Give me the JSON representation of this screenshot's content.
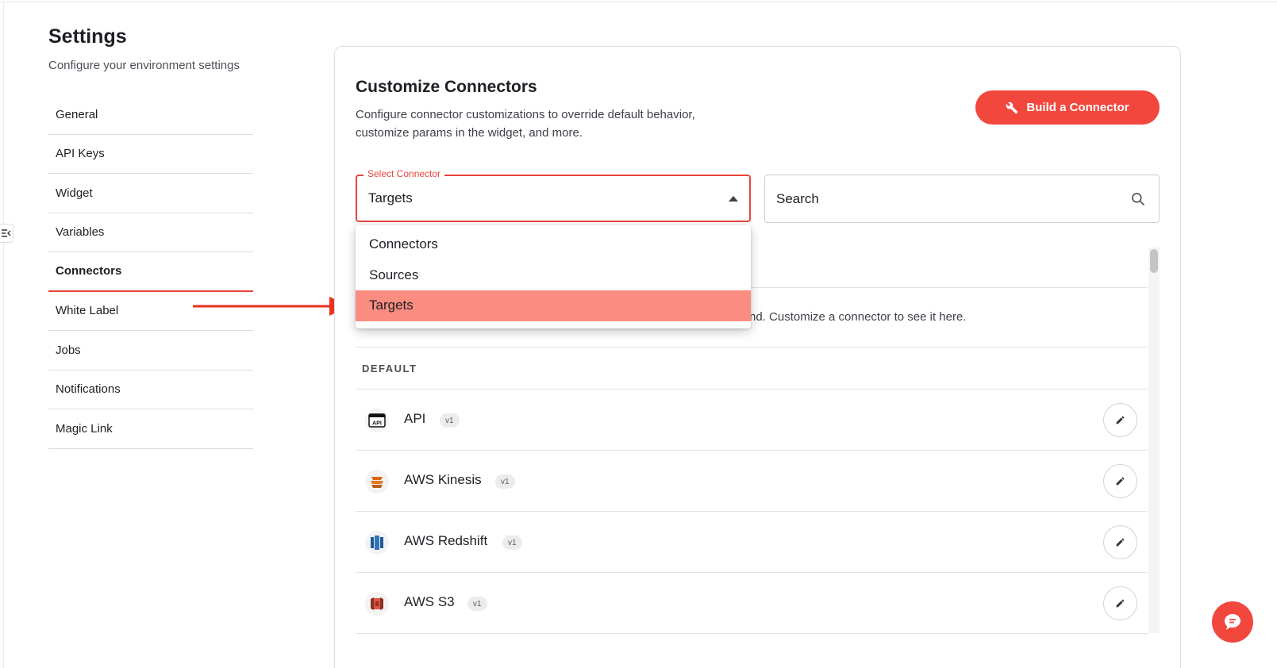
{
  "sidebar": {
    "title": "Settings",
    "subtitle": "Configure your environment settings",
    "items": [
      {
        "label": "General"
      },
      {
        "label": "API Keys"
      },
      {
        "label": "Widget"
      },
      {
        "label": "Variables"
      },
      {
        "label": "Connectors",
        "active": true
      },
      {
        "label": "White Label"
      },
      {
        "label": "Jobs"
      },
      {
        "label": "Notifications"
      },
      {
        "label": "Magic Link"
      }
    ]
  },
  "main": {
    "title": "Customize Connectors",
    "description_line1": "Configure connector customizations to override default behavior,",
    "description_line2": "customize params in the widget, and more.",
    "build_button_label": "Build a Connector",
    "select": {
      "legend": "Select Connector",
      "value": "Targets",
      "options": [
        "Connectors",
        "Sources",
        "Targets"
      ],
      "selected_index": 2
    },
    "search": {
      "placeholder": "Search"
    },
    "empty_text_visible": "nd. Customize a connector to see it here.",
    "section_label": "DEFAULT",
    "connectors": [
      {
        "name": "API",
        "version": "v1",
        "icon": "api-logo-icon"
      },
      {
        "name": "AWS Kinesis",
        "version": "v1",
        "icon": "aws-kinesis-logo-icon"
      },
      {
        "name": "AWS Redshift",
        "version": "v1",
        "icon": "aws-redshift-logo-icon"
      },
      {
        "name": "AWS S3",
        "version": "v1",
        "icon": "aws-s3-logo-icon"
      }
    ]
  },
  "colors": {
    "accent": "#f2473d",
    "selected_option": "#fa8c80",
    "arrow": "#e8321f"
  }
}
